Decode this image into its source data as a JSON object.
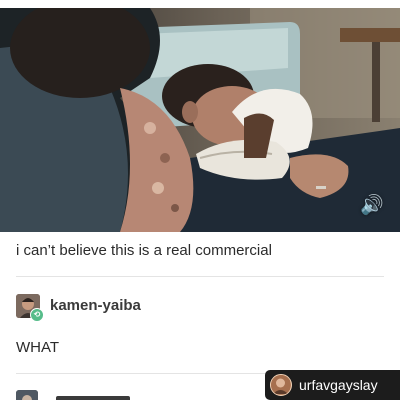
{
  "post": {
    "caption": "i can’t believe this is a real commercial",
    "video": {
      "sound": "on"
    }
  },
  "reblog": {
    "username": "kamen-yaiba",
    "text": "WHAT"
  },
  "watermark": {
    "handle": "urfavgayslay"
  },
  "icons": {
    "volume": "volume-icon",
    "reblog": "reblog-icon"
  },
  "colors": {
    "reblog_green": "#56bc8a",
    "text": "#2b2b2b",
    "watermark_bg": "#1c1c1c"
  }
}
